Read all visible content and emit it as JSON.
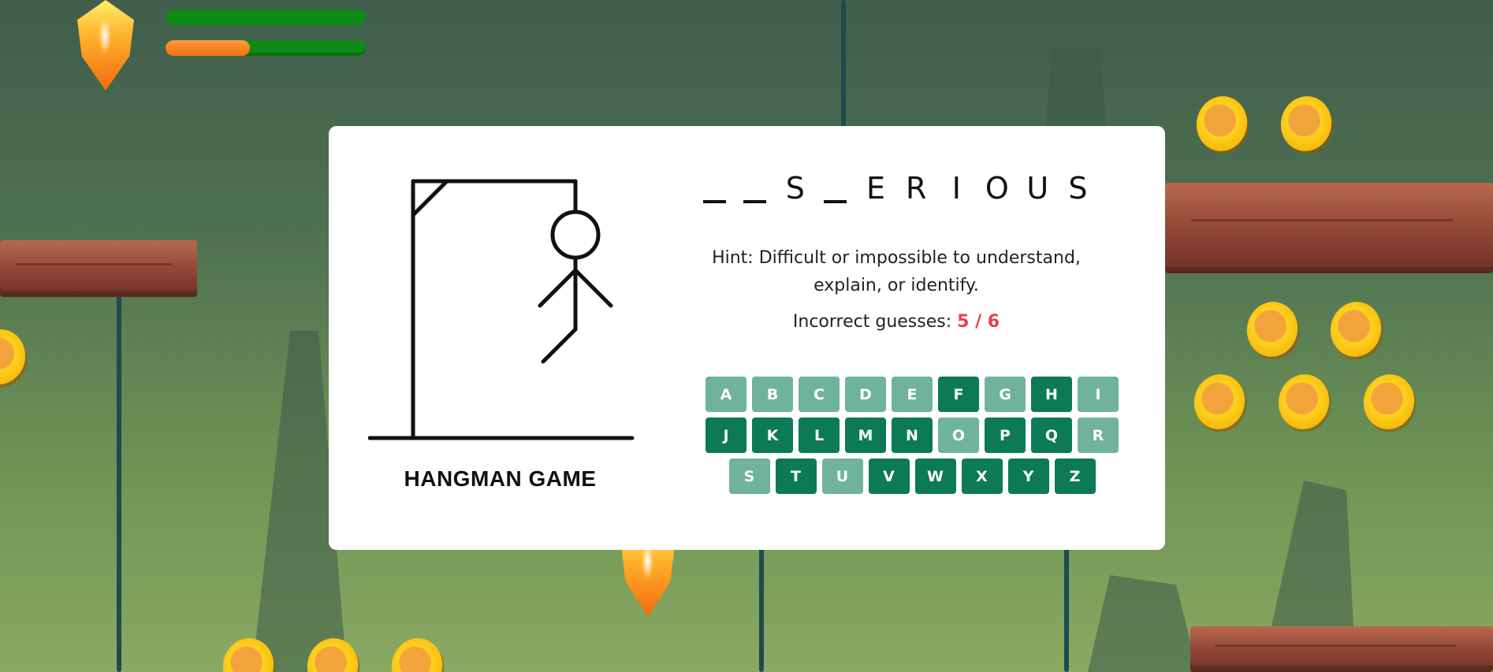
{
  "hud": {
    "health_level": 1.0,
    "energy_level": 0.42,
    "health_color": "#0f8a16",
    "energy_color": "#f06f0f",
    "gem_icon": "gem-icon"
  },
  "card": {
    "title": "HANGMAN GAME",
    "word": [
      "",
      "",
      "S",
      "",
      "E",
      "R",
      "I",
      "O",
      "U",
      "S"
    ],
    "hint_label": "Hint:",
    "hint_text": "Difficult or impossible to understand, explain, or identify.",
    "incorrect_label": "Incorrect guesses:",
    "incorrect_value": "5 / 6",
    "incorrect_color": "#e0444c"
  },
  "keyboard": {
    "colors": {
      "used": "#6fb39c",
      "available": "#0b7a55"
    },
    "keys": [
      {
        "label": "A",
        "used": true
      },
      {
        "label": "B",
        "used": true
      },
      {
        "label": "C",
        "used": true
      },
      {
        "label": "D",
        "used": true
      },
      {
        "label": "E",
        "used": true
      },
      {
        "label": "F",
        "used": false
      },
      {
        "label": "G",
        "used": true
      },
      {
        "label": "H",
        "used": false
      },
      {
        "label": "I",
        "used": true
      },
      {
        "label": "J",
        "used": false
      },
      {
        "label": "K",
        "used": false
      },
      {
        "label": "L",
        "used": false
      },
      {
        "label": "M",
        "used": false
      },
      {
        "label": "N",
        "used": false
      },
      {
        "label": "O",
        "used": true
      },
      {
        "label": "P",
        "used": false
      },
      {
        "label": "Q",
        "used": false
      },
      {
        "label": "R",
        "used": true
      },
      {
        "label": "S",
        "used": true
      },
      {
        "label": "T",
        "used": false
      },
      {
        "label": "U",
        "used": true
      },
      {
        "label": "V",
        "used": false
      },
      {
        "label": "W",
        "used": false
      },
      {
        "label": "X",
        "used": false
      },
      {
        "label": "Y",
        "used": false
      },
      {
        "label": "Z",
        "used": false
      }
    ]
  }
}
